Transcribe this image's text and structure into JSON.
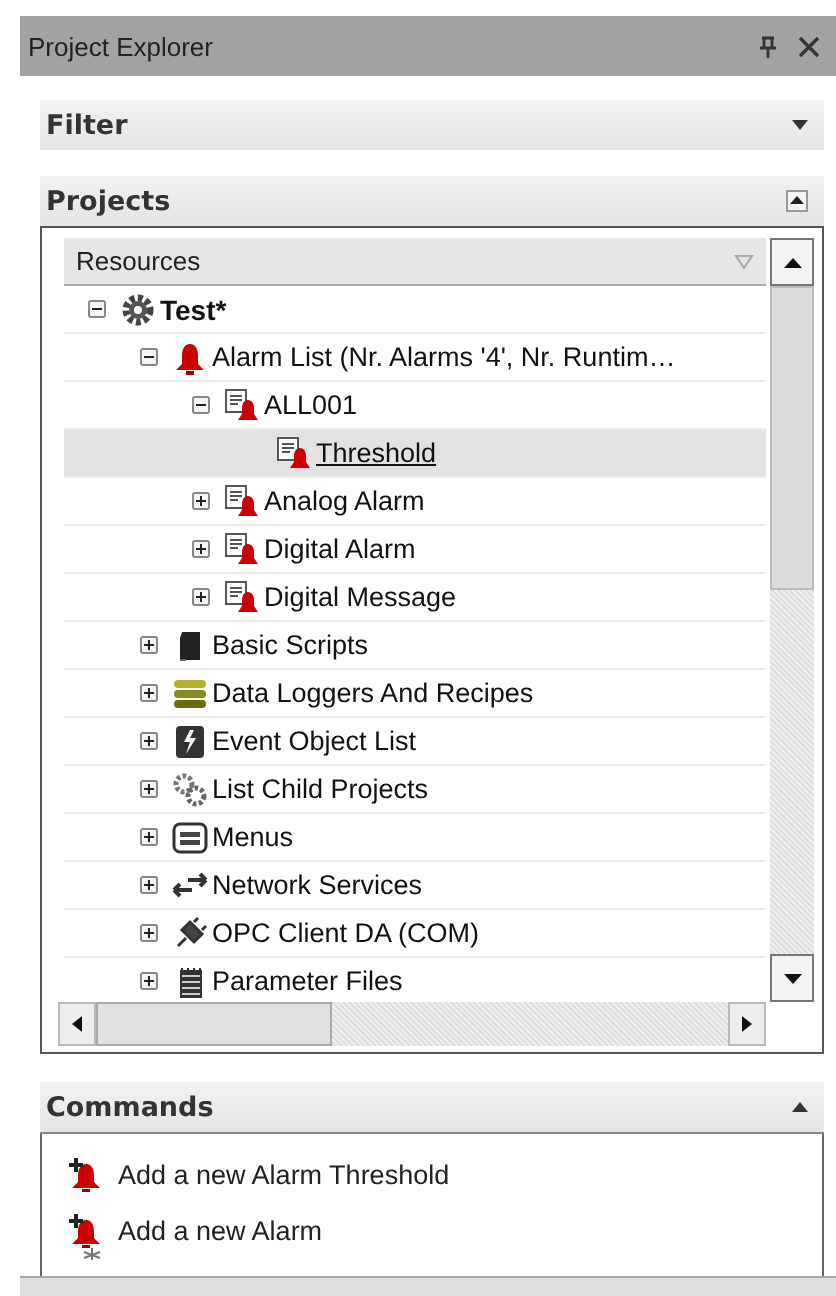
{
  "window": {
    "title": "Project Explorer"
  },
  "filter": {
    "title": "Filter",
    "expanded": false
  },
  "projects": {
    "title": "Projects",
    "expanded": true,
    "column": "Resources",
    "items": [
      {
        "label": "Test*",
        "kind": "gear",
        "expanded": true,
        "selected": false,
        "children": [
          {
            "label": "Alarm List (Nr. Alarms '4', Nr. Runtim…",
            "kind": "bell",
            "expanded": true,
            "selected": false,
            "children": [
              {
                "label": "ALL001",
                "kind": "alarm-doc",
                "expanded": true,
                "selected": false,
                "children": [
                  {
                    "label": "Threshold",
                    "kind": "alarm-doc",
                    "selected": true
                  }
                ]
              },
              {
                "label": "Analog Alarm",
                "kind": "alarm-doc",
                "expanded": false,
                "selected": false
              },
              {
                "label": "Digital Alarm",
                "kind": "alarm-doc",
                "expanded": false,
                "selected": false
              },
              {
                "label": "Digital Message",
                "kind": "alarm-doc",
                "expanded": false,
                "selected": false
              }
            ]
          },
          {
            "label": "Basic Scripts",
            "kind": "script",
            "expanded": false,
            "selected": false
          },
          {
            "label": "Data Loggers And Recipes",
            "kind": "database",
            "expanded": false,
            "selected": false
          },
          {
            "label": "Event Object List",
            "kind": "event",
            "expanded": false,
            "selected": false
          },
          {
            "label": "List Child Projects",
            "kind": "gears",
            "expanded": false,
            "selected": false
          },
          {
            "label": "Menus",
            "kind": "menu",
            "expanded": false,
            "selected": false
          },
          {
            "label": "Network Services",
            "kind": "network",
            "expanded": false,
            "selected": false
          },
          {
            "label": "OPC Client DA (COM)",
            "kind": "opc",
            "expanded": false,
            "selected": false
          },
          {
            "label": "Parameter Files",
            "kind": "file",
            "expanded": false,
            "selected": false
          }
        ]
      }
    ]
  },
  "commands": {
    "title": "Commands",
    "expanded": true,
    "items": [
      {
        "label": "Add a new Alarm Threshold",
        "kind": "add-bell"
      },
      {
        "label": "Add a new Alarm",
        "kind": "add-bell"
      }
    ]
  }
}
